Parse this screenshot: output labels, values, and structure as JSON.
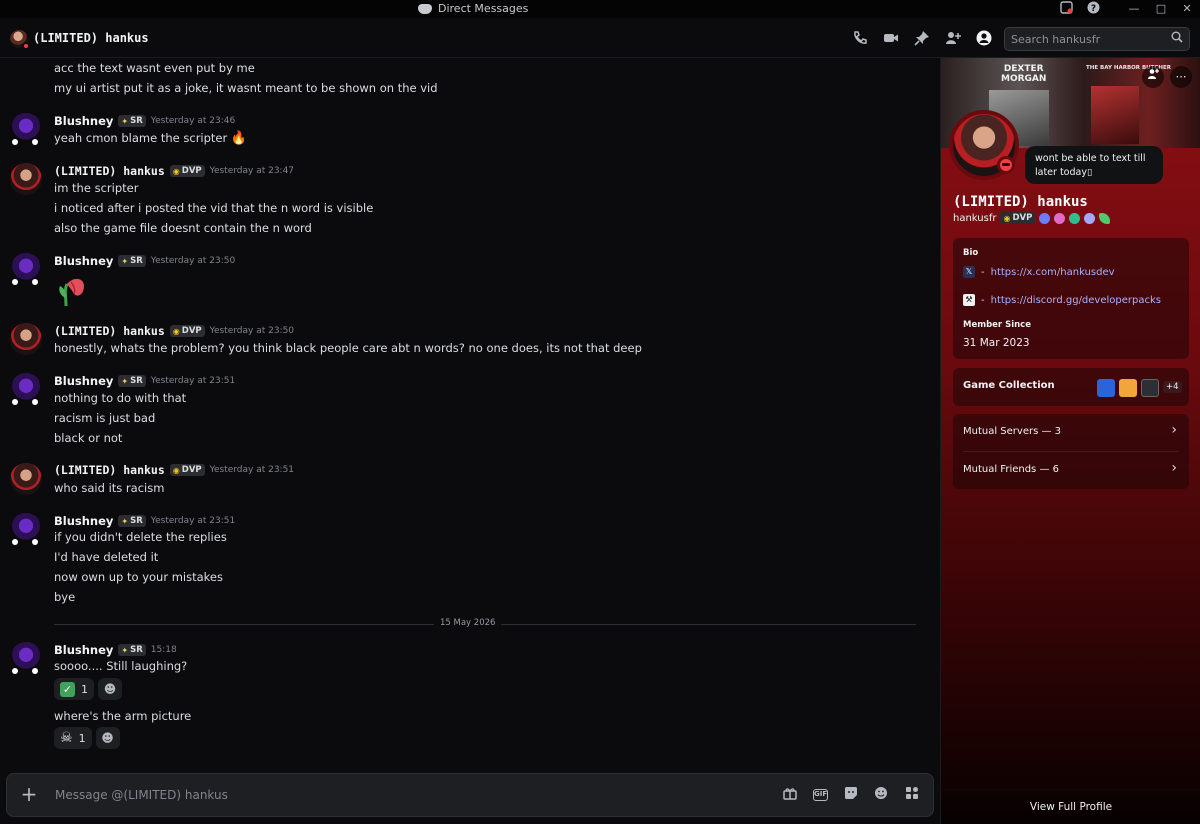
{
  "window": {
    "title": "Direct Messages"
  },
  "header": {
    "name": "(LIMITED) hankus",
    "search_placeholder": "Search hankusfr"
  },
  "messages": [
    {
      "kind": "cont",
      "text": "acc the text wasnt even put by me"
    },
    {
      "kind": "cont",
      "text": "my ui artist put it as a joke, it wasnt meant to be shown on the vid"
    },
    {
      "kind": "head",
      "user": "Blushney",
      "tag": "SR",
      "time": "Yesterday at 23:46"
    },
    {
      "kind": "cont",
      "text": "yeah cmon blame the scripter"
    },
    {
      "kind": "head",
      "user": "(LIMITED) hankus",
      "tag": "DVP",
      "time": "Yesterday at 23:47"
    },
    {
      "kind": "cont",
      "text": "im the scripter"
    },
    {
      "kind": "cont",
      "text": "i noticed after i posted the vid that the n word is visible"
    },
    {
      "kind": "cont",
      "text": "also the game file doesnt contain the n word"
    },
    {
      "kind": "head",
      "user": "Blushney",
      "tag": "SR",
      "time": "Yesterday at 23:50"
    },
    {
      "kind": "head",
      "user": "(LIMITED) hankus",
      "tag": "DVP",
      "time": "Yesterday at 23:50"
    },
    {
      "kind": "cont",
      "text": "honestly, whats the problem? you think black people care abt n words? no one does, its not that deep"
    },
    {
      "kind": "head",
      "user": "Blushney",
      "tag": "SR",
      "time": "Yesterday at 23:51"
    },
    {
      "kind": "cont",
      "text": "nothing to do with that"
    },
    {
      "kind": "cont",
      "text": "racism is just bad"
    },
    {
      "kind": "cont",
      "text": "black or not"
    },
    {
      "kind": "head",
      "user": "(LIMITED) hankus",
      "tag": "DVP",
      "time": "Yesterday at 23:51"
    },
    {
      "kind": "cont",
      "text": "who said its racism"
    },
    {
      "kind": "head",
      "user": "Blushney",
      "tag": "SR",
      "time": "Yesterday at 23:51"
    },
    {
      "kind": "cont",
      "text": "if you didn't delete the replies"
    },
    {
      "kind": "cont",
      "text": "I'd have deleted it"
    },
    {
      "kind": "cont",
      "text": "now own up to your mistakes"
    },
    {
      "kind": "cont",
      "text": "bye"
    },
    {
      "kind": "head",
      "user": "Blushney",
      "tag": "SR",
      "time": "15:18"
    },
    {
      "kind": "cont",
      "text": "soooo.... Still laughing?"
    },
    {
      "kind": "cont",
      "text": "where's the arm picture"
    }
  ],
  "date_divider": "15 May 2026",
  "reactions": [
    {
      "icon": "check-mark-icon",
      "count": "1"
    },
    {
      "icon": "skull-icon",
      "count": "1"
    }
  ],
  "composer": {
    "placeholder": "Message @(LIMITED) hankus"
  },
  "profile": {
    "banner_title": "DEXTER\nMORGAN",
    "banner_subtitle": "THE BAY HARBOR BUTCHER",
    "custom_status": "wont be able to text till later today⁠▯",
    "display_name": "(LIMITED) hankus",
    "username": "hankusfr",
    "username_tag": "DVP",
    "bio_label": "Bio",
    "bio_links": [
      {
        "dash": "-",
        "url": "https://x.com/hankusdev"
      },
      {
        "dash": "-",
        "url": "https://discord.gg/developerpacks"
      }
    ],
    "member_since_label": "Member Since",
    "member_since": "31 Mar 2023",
    "game_collection_label": "Game Collection",
    "game_collection_more": "+4",
    "mutual_servers": "Mutual Servers — 3",
    "mutual_friends": "Mutual Friends — 6",
    "view_full": "View Full Profile"
  },
  "colors": {
    "accent_red": "#8e0f14",
    "dnd": "#f23f43",
    "link": "#a8b3ff",
    "bg": "#0b0b0d"
  }
}
